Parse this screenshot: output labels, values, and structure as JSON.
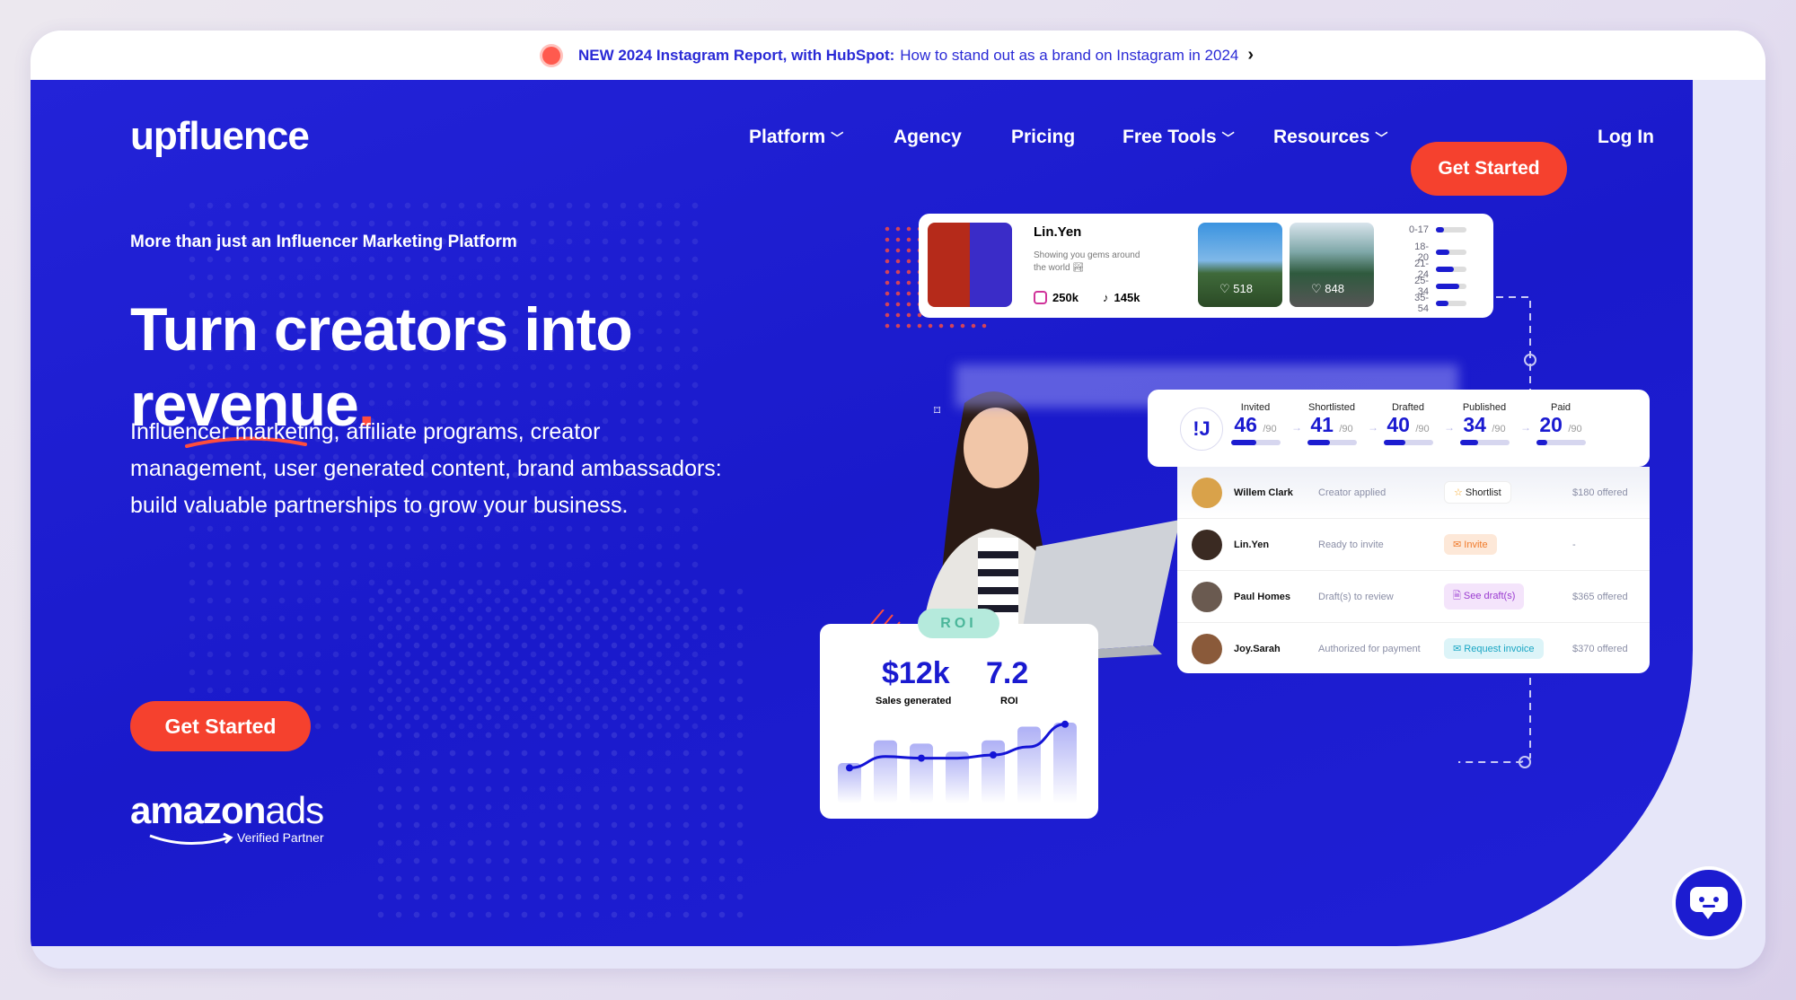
{
  "banner": {
    "bold": "NEW 2024 Instagram Report, with HubSpot:",
    "text": "How to stand out as a brand on Instagram in 2024",
    "icon": "chevron-right-icon"
  },
  "header": {
    "logo": "upfluence",
    "nav": [
      {
        "label": "Platform",
        "dropdown": true
      },
      {
        "label": "Agency"
      },
      {
        "label": "Pricing"
      },
      {
        "label": "Free Tools",
        "dropdown": true
      },
      {
        "label": "Resources",
        "dropdown": true
      }
    ],
    "cta": "Get Started",
    "login": "Log In"
  },
  "hero": {
    "tagline": "More than just an Influencer Marketing Platform",
    "title_line1": "Turn creators into",
    "title_line2": "revenue",
    "title_dot": ".",
    "description": "Influencer marketing, affiliate programs, creator management, user generated content, brand ambassadors: build valuable partnerships to grow your business.",
    "cta": "Get Started",
    "partner": {
      "brand": "amazon",
      "brand2": "ads",
      "label": "Verified Partner"
    }
  },
  "profile_card": {
    "name": "Lin.Yen",
    "bio": "Showing you gems around the world 🏞",
    "instagram": "250k",
    "tiktok": "145k",
    "posts": [
      {
        "likes": "518"
      },
      {
        "likes": "848"
      }
    ],
    "ages": [
      {
        "label": "0-17",
        "fraction": 0.25
      },
      {
        "label": "18-20",
        "fraction": 0.45
      },
      {
        "label": "21-24",
        "fraction": 0.6
      },
      {
        "label": "25-34",
        "fraction": 0.75
      },
      {
        "label": "35-54",
        "fraction": 0.4
      }
    ]
  },
  "pipeline": {
    "total": "/90",
    "stages": [
      {
        "label": "Invited",
        "value": "46",
        "fraction": 0.51
      },
      {
        "label": "Shortlisted",
        "value": "41",
        "fraction": 0.46
      },
      {
        "label": "Drafted",
        "value": "40",
        "fraction": 0.44
      },
      {
        "label": "Published",
        "value": "34",
        "fraction": 0.38
      },
      {
        "label": "Paid",
        "value": "20",
        "fraction": 0.22
      }
    ],
    "rows": [
      {
        "name": "Willem Clark",
        "status": "Creator applied",
        "action": "Shortlist",
        "action_icon": "star-icon",
        "offer": "$180 offered",
        "color": "#222222",
        "bg": "#ffffff"
      },
      {
        "name": "Lin.Yen",
        "status": "Ready to invite",
        "action": "Invite",
        "action_icon": "mail-icon",
        "offer": "-",
        "color": "#f07a2a",
        "bg": "#fde8d8"
      },
      {
        "name": "Paul Homes",
        "status": "Draft(s) to review",
        "action": "See draft(s)",
        "action_icon": "document-icon",
        "offer": "$365 offered",
        "color": "#9a3cd0",
        "bg": "#f4e4fb"
      },
      {
        "name": "Joy.Sarah",
        "status": "Authorized for payment",
        "action": "Request invoice",
        "action_icon": "mail-icon",
        "offer": "$370 offered",
        "color": "#1aa6c4",
        "bg": "#dcf4f8"
      }
    ]
  },
  "roi_card": {
    "pill": "ROI",
    "sales": "$12k",
    "sales_label": "Sales generated",
    "roi": "7.2",
    "roi_label": "ROI",
    "bars": [
      0.5,
      0.78,
      0.74,
      0.64,
      0.78,
      0.95,
      1.0
    ],
    "line": [
      0.44,
      0.58,
      0.56,
      0.56,
      0.6,
      0.7,
      0.98
    ]
  },
  "colors": {
    "brand_blue": "#1c1cd0",
    "accent_red": "#f5412e",
    "banner_text": "#2a2ad6"
  }
}
